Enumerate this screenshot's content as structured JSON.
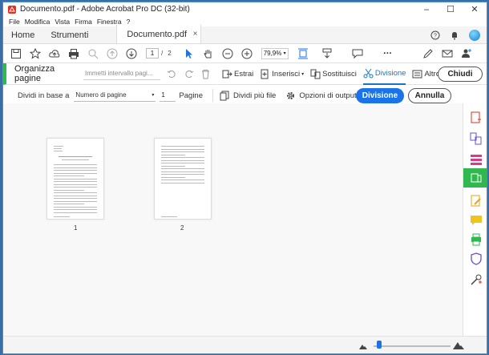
{
  "window": {
    "title": "Documento.pdf - Adobe Acrobat Pro DC (32-bit)",
    "min_label": "–",
    "max_label": "☐",
    "close_label": "✕"
  },
  "menu": [
    "File",
    "Modifica",
    "Vista",
    "Firma",
    "Finestra",
    "?"
  ],
  "tabs": {
    "home": "Home",
    "tools": "Strumenti",
    "document": "Documento.pdf",
    "close": "×"
  },
  "toolbar": {
    "page_current": "1",
    "page_separator": "/",
    "page_total": "2",
    "zoom": "79,9%",
    "more": "···"
  },
  "organize": {
    "title": "Organizza pagine",
    "range_placeholder": "Immetti intervallo pagi...",
    "tools": [
      "Estrai",
      "Inserisci",
      "Sostituisci",
      "Divisione",
      "Altro"
    ],
    "active_tool": "Divisione",
    "close_button": "Chiudi"
  },
  "split": {
    "divide_by_label": "Dividi in base a",
    "divide_by_value": "Numero di pagine",
    "pages_count": "1",
    "pages_label": "Pagine",
    "split_more_files": "Dividi più file",
    "output_options": "Opzioni di output",
    "divide_button": "Divisione",
    "cancel_button": "Annulla"
  },
  "pages": [
    {
      "number": "1"
    },
    {
      "number": "2"
    }
  ],
  "colors": {
    "accent_blue": "#1a73e8",
    "organize_green": "#2eb84d",
    "acrobat_red": "#e0311f"
  },
  "right_panel_icons": [
    "create-pdf-icon",
    "combine-files-icon",
    "organize-pages-icon",
    "export-pdf-icon",
    "organize-pages-active-icon",
    "edit-pdf-icon",
    "comment-icon",
    "print-production-icon",
    "protect-icon",
    "more-tools-icon"
  ]
}
